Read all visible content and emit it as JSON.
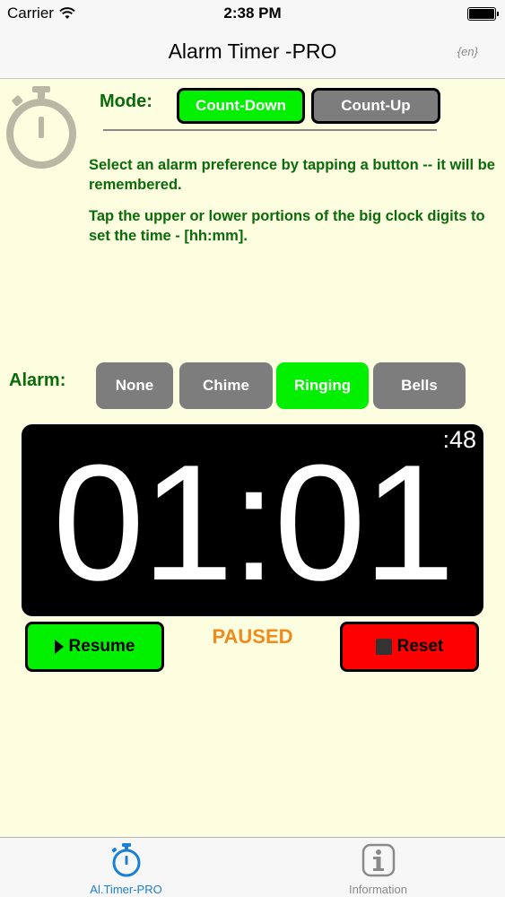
{
  "status_bar": {
    "carrier": "Carrier",
    "time": "2:38 PM"
  },
  "nav": {
    "title": "Alarm Timer -PRO",
    "language": "{en}"
  },
  "mode": {
    "label": "Mode:",
    "options": [
      "Count-Down",
      "Count-Up"
    ],
    "selected": "Count-Down"
  },
  "instructions": [
    "Select an alarm preference by tapping a button -- it will be remembered.",
    "Tap the upper or lower portions of the big clock digits to set the time - [hh:mm]."
  ],
  "alarm": {
    "label": "Alarm:",
    "options": [
      "None",
      "Chime",
      "Ringing",
      "Bells"
    ],
    "selected": "Ringing"
  },
  "clock": {
    "time": "01:01",
    "seconds": ":48"
  },
  "controls": {
    "resume_label": "Resume",
    "status": "PAUSED",
    "reset_label": "Reset"
  },
  "tabs": [
    {
      "label": "Al.Timer-PRO",
      "icon": "stopwatch-icon",
      "active": true
    },
    {
      "label": "Information",
      "icon": "info-icon",
      "active": false
    }
  ],
  "colors": {
    "background": "#fdfde0",
    "accent_green": "#00f000",
    "text_green": "#0a6b0a",
    "inactive_gray": "#7d7d7d",
    "reset_red": "#ff0000",
    "paused_orange": "#f08a1c",
    "tab_active_blue": "#1a7fd6"
  }
}
